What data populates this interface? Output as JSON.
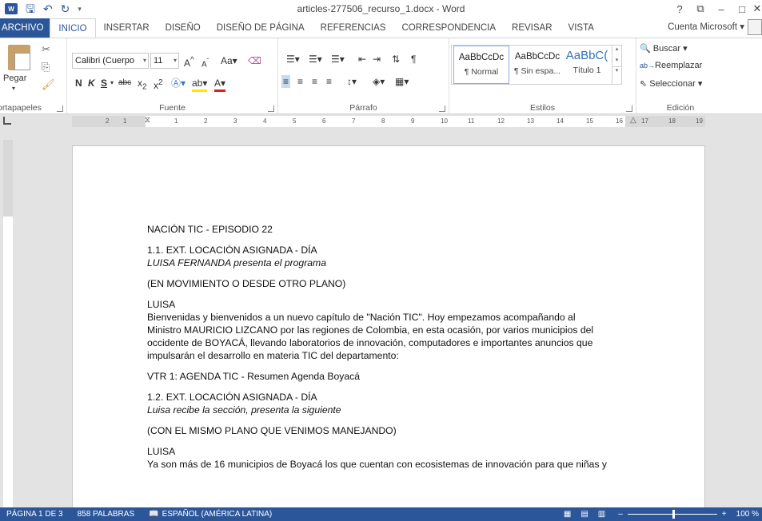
{
  "title": "articles-277506_recurso_1.docx - Word",
  "window_controls": [
    "?",
    "⧉",
    "–",
    "□",
    "✕"
  ],
  "tabs": [
    {
      "label": "ARCHIVO",
      "active": false,
      "file": true
    },
    {
      "label": "INICIO",
      "active": true
    },
    {
      "label": "INSERTAR",
      "active": false
    },
    {
      "label": "DISEÑO",
      "active": false
    },
    {
      "label": "DISEÑO DE PÁGINA",
      "active": false
    },
    {
      "label": "REFERENCIAS",
      "active": false
    },
    {
      "label": "CORRESPONDENCIA",
      "active": false
    },
    {
      "label": "REVISAR",
      "active": false
    },
    {
      "label": "VISTA",
      "active": false
    }
  ],
  "account": "Cuenta Microsoft",
  "ribbon": {
    "clipboard": {
      "label": "Portapapeles",
      "paste": "Pegar"
    },
    "font": {
      "label": "Fuente",
      "font_name": "Calibri (Cuerpo",
      "font_size": "11"
    },
    "paragraph": {
      "label": "Párrafo"
    },
    "styles": {
      "label": "Estilos",
      "items": [
        {
          "sample": "AaBbCcDc",
          "name": "¶ Normal"
        },
        {
          "sample": "AaBbCcDc",
          "name": "¶ Sin espa..."
        },
        {
          "sample": "AaBbC(",
          "name": "Título 1"
        }
      ]
    },
    "editing": {
      "label": "Edición",
      "find": "Buscar",
      "replace": "Reemplazar",
      "select": "Seleccionar"
    }
  },
  "ruler": {
    "numbers": [
      "2",
      "1",
      "1",
      "2",
      "3",
      "4",
      "5",
      "6",
      "7",
      "8",
      "9",
      "10",
      "11",
      "12",
      "13",
      "14",
      "15",
      "16",
      "17",
      "18",
      "19"
    ]
  },
  "document": {
    "paragraphs": [
      {
        "lines": [
          "NACIÓN TIC - EPISODIO 22"
        ]
      },
      {
        "lines": [
          "1.1. EXT. LOCACIÓN ASIGNADA - DÍA"
        ],
        "italic_line": "LUISA FERNANDA presenta el programa"
      },
      {
        "lines": [
          "(EN MOVIMIENTO O DESDE OTRO PLANO)"
        ]
      },
      {
        "lines": [
          "LUISA",
          "Bienvenidas y bienvenidos a un nuevo capítulo de \"Nación TIC\". Hoy empezamos acompañando al",
          "Ministro MAURICIO LIZCANO por las regiones de Colombia, en esta ocasión, por varios municipios del",
          "occidente de BOYACÁ, llevando laboratorios de innovación, computadores e importantes anuncios que",
          "impulsarán el desarrollo en materia TIC del departamento:"
        ]
      },
      {
        "lines": [
          "VTR 1: AGENDA TIC - Resumen Agenda Boyacá"
        ]
      },
      {
        "lines": [
          "1.2. EXT. LOCACIÓN ASIGNADA - DÍA"
        ],
        "italic_line": "Luisa recibe la sección, presenta la siguiente"
      },
      {
        "lines": [
          "(CON EL MISMO PLANO QUE VENIMOS MANEJANDO)"
        ]
      },
      {
        "lines": [
          "LUISA",
          "Ya son más de 16 municipios de Boyacá los que cuentan con ecosistemas de innovación para que niñas y"
        ]
      }
    ]
  },
  "status": {
    "page": "PÁGINA 1 DE 3",
    "words": "858 PALABRAS",
    "language": "ESPAÑOL (AMÉRICA LATINA)",
    "zoom": "100 %",
    "zoom_fraction": 0.5
  }
}
